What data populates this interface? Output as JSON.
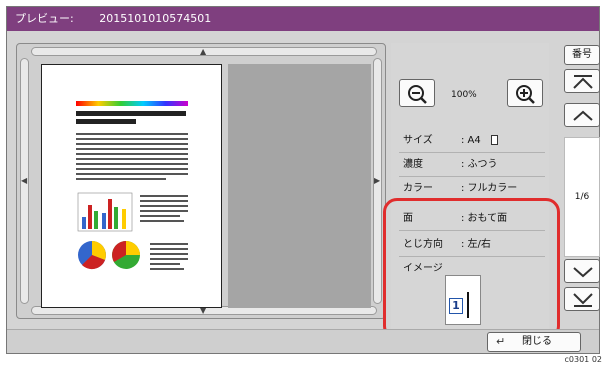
{
  "titlebar": {
    "title": "プレビュー:",
    "filename": "2015101010574501"
  },
  "zoom": {
    "value": "100%"
  },
  "properties": [
    {
      "label": "サイズ",
      "value": ": A4"
    },
    {
      "label": "濃度",
      "value": ": ふつう"
    },
    {
      "label": "カラー",
      "value": ": フルカラー"
    },
    {
      "label": "面",
      "value": ": おもて面"
    },
    {
      "label": "とじ方向",
      "value": ": 左/右"
    }
  ],
  "image_section": {
    "label": "イメージ",
    "page_number": "1"
  },
  "side": {
    "number_label": "番号",
    "page_counter": "1/6"
  },
  "footer": {
    "close_label": "閉じる",
    "code": "c0301 02"
  },
  "colors": {
    "titlebar": "#7f3f7f",
    "highlight": "#e02d2d"
  }
}
